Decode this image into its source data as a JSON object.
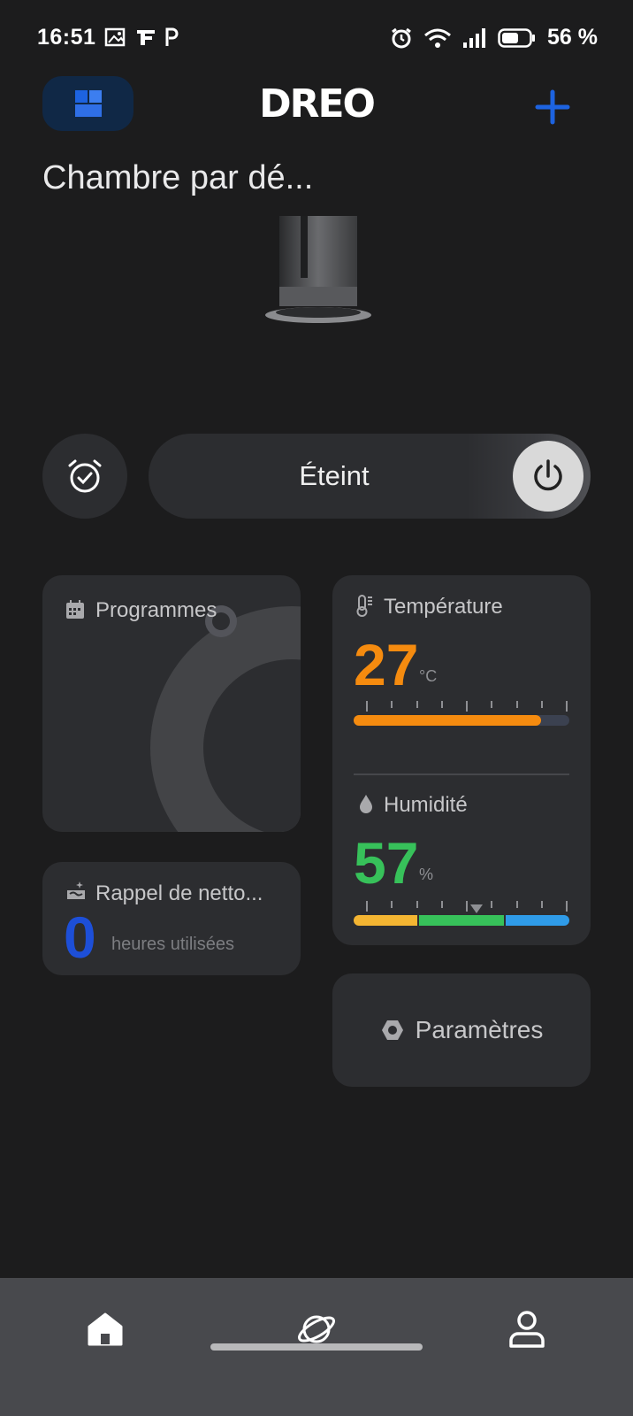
{
  "status_bar": {
    "time": "16:51",
    "battery": "56 %",
    "icons": [
      "image-icon",
      "alert-icon",
      "app-f-icon",
      "app-p-icon",
      "alarm-icon",
      "wifi-icon",
      "signal-icon",
      "battery-icon"
    ]
  },
  "header": {
    "logo": "DREO",
    "add_icon": "plus-icon",
    "switch_icon": "grid-icon"
  },
  "room": {
    "title": "Chambre par dé..."
  },
  "controls": {
    "timer_icon": "alarm-check-icon",
    "power_state": "Éteint",
    "power_icon": "power-icon"
  },
  "cards": {
    "programs": {
      "title": "Programmes",
      "icon": "calendar-icon"
    },
    "temperature": {
      "title": "Température",
      "value": "27",
      "unit": "°C",
      "level": 0.87,
      "color": "#f58b0f"
    },
    "humidity": {
      "title": "Humidité",
      "value": "57",
      "unit": "%",
      "marker": 0.57,
      "color": "#37c15a"
    },
    "cleaning": {
      "title": "Rappel de netto...",
      "value": "0",
      "caption": "heures utilisées",
      "color": "#1d4fd8"
    },
    "settings": {
      "label": "Paramètres",
      "icon": "hexagon-icon"
    }
  },
  "nav": {
    "items": [
      {
        "name": "home",
        "icon": "home-icon"
      },
      {
        "name": "explore",
        "icon": "planet-icon"
      },
      {
        "name": "profile",
        "icon": "user-icon"
      }
    ]
  },
  "colors": {
    "background": "#1c1c1d",
    "card": "#2c2d30",
    "accent": "#1d63e0"
  }
}
